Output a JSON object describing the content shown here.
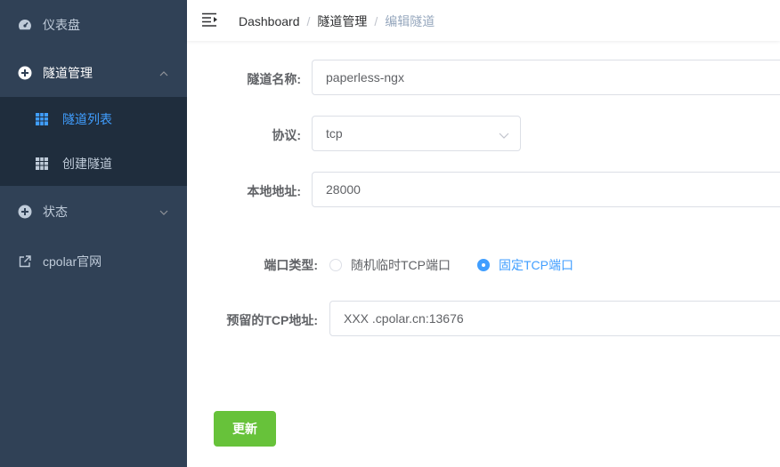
{
  "sidebar": {
    "items": [
      {
        "label": "仪表盘",
        "icon": "dashboard-icon"
      },
      {
        "label": "隧道管理",
        "icon": "plus-circle-icon",
        "expanded": true
      },
      {
        "label": "状态",
        "icon": "plus-circle-icon",
        "expanded": false
      },
      {
        "label": "cpolar官网",
        "icon": "external-link-icon"
      }
    ],
    "subitems": [
      {
        "label": "隧道列表",
        "icon": "table-icon",
        "active": true
      },
      {
        "label": "创建隧道",
        "icon": "table-icon",
        "active": false
      }
    ]
  },
  "header": {
    "breadcrumb": [
      "Dashboard",
      "隧道管理",
      "编辑隧道"
    ]
  },
  "form": {
    "name": {
      "label": "隧道名称:",
      "value": "paperless-ngx"
    },
    "protocol": {
      "label": "协议:",
      "value": "tcp"
    },
    "local_addr": {
      "label": "本地地址:",
      "value": "28000"
    },
    "port_type": {
      "label": "端口类型:",
      "options": [
        "随机临时TCP端口",
        "固定TCP端口"
      ],
      "selected": "固定TCP端口"
    },
    "reserved_tcp": {
      "label": "预留的TCP地址:",
      "value": "XXX .cpolar.cn:13676"
    },
    "submit_label": "更新"
  },
  "colors": {
    "sidebar_bg": "#304156",
    "submenu_bg": "#1f2d3d",
    "active": "#409eff",
    "button": "#67c23a"
  }
}
